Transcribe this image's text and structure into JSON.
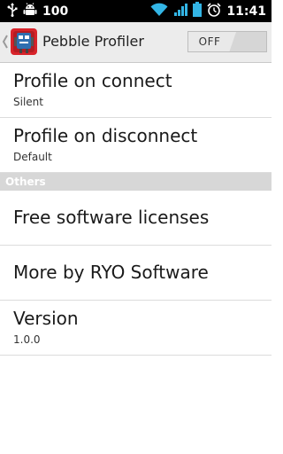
{
  "status_bar": {
    "battery_percent": "100",
    "time": "11:41",
    "icons": [
      "usb-icon",
      "android-debug-icon",
      "wifi-icon",
      "signal-icon",
      "battery-icon",
      "alarm-icon"
    ]
  },
  "action_bar": {
    "title": "Pebble Profiler",
    "toggle_label": "OFF",
    "app_icon": "pebble-robot-icon"
  },
  "preferences": {
    "profile_on_connect": {
      "title": "Profile on connect",
      "summary": "Silent"
    },
    "profile_on_disconnect": {
      "title": "Profile on disconnect",
      "summary": "Default"
    },
    "category_others": "Others",
    "free_software_licenses": {
      "title": "Free software licenses"
    },
    "more_by": {
      "title": "More by RYO Software"
    },
    "version": {
      "title": "Version",
      "summary": "1.0.0"
    }
  },
  "colors": {
    "status_bar_bg": "#000000",
    "action_bar_bg": "#ececec",
    "category_bg": "#d7d7d7",
    "wifi_accent": "#33b5e5",
    "app_icon_red": "#d8232a"
  }
}
